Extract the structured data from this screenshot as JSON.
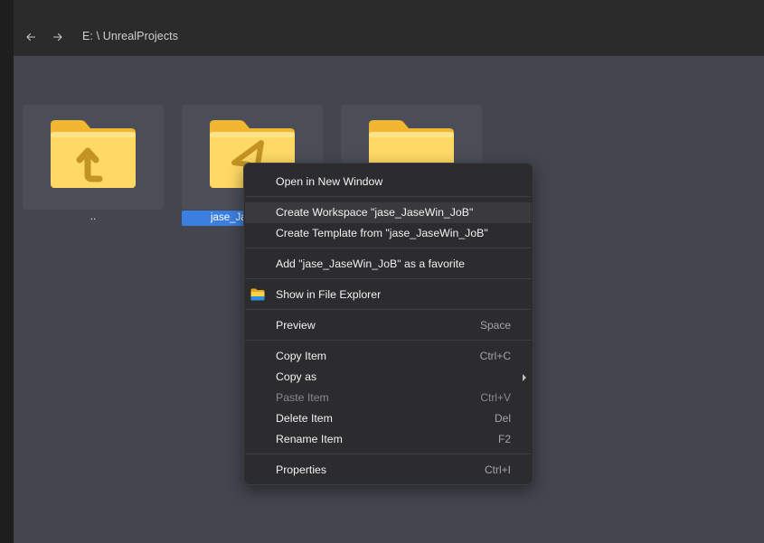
{
  "address_bar": {
    "path": "E: \\ UnrealProjects"
  },
  "tiles": [
    {
      "label": "..",
      "icon": "folder-up-icon"
    },
    {
      "label": "jase_Ja",
      "icon": "folder-unreal-icon",
      "selected": true
    },
    {
      "label": "",
      "icon": "folder-icon"
    }
  ],
  "context_menu": {
    "open_new_window": {
      "label": "Open in New Window"
    },
    "create_workspace": {
      "label": "Create Workspace \"jase_JaseWin_JoB\""
    },
    "create_template": {
      "label": "Create Template from \"jase_JaseWin_JoB\""
    },
    "add_favorite": {
      "label": "Add \"jase_JaseWin_JoB\" as a favorite"
    },
    "show_explorer": {
      "label": "Show in File Explorer",
      "icon": "file-explorer-icon"
    },
    "preview": {
      "label": "Preview",
      "shortcut": "Space"
    },
    "copy_item": {
      "label": "Copy Item",
      "shortcut": "Ctrl+C"
    },
    "copy_as": {
      "label": "Copy as"
    },
    "paste_item": {
      "label": "Paste Item",
      "shortcut": "Ctrl+V",
      "disabled": true
    },
    "delete_item": {
      "label": "Delete Item",
      "shortcut": "Del"
    },
    "rename_item": {
      "label": "Rename Item",
      "shortcut": "F2"
    },
    "properties": {
      "label": "Properties",
      "shortcut": "Ctrl+I"
    }
  },
  "colors": {
    "content_bg": "#44464f",
    "tile_bg": "#4c4e57",
    "selection": "#3b7fe1",
    "menu_bg": "#2c2c2e",
    "folder_yellow": "#ffd966"
  }
}
